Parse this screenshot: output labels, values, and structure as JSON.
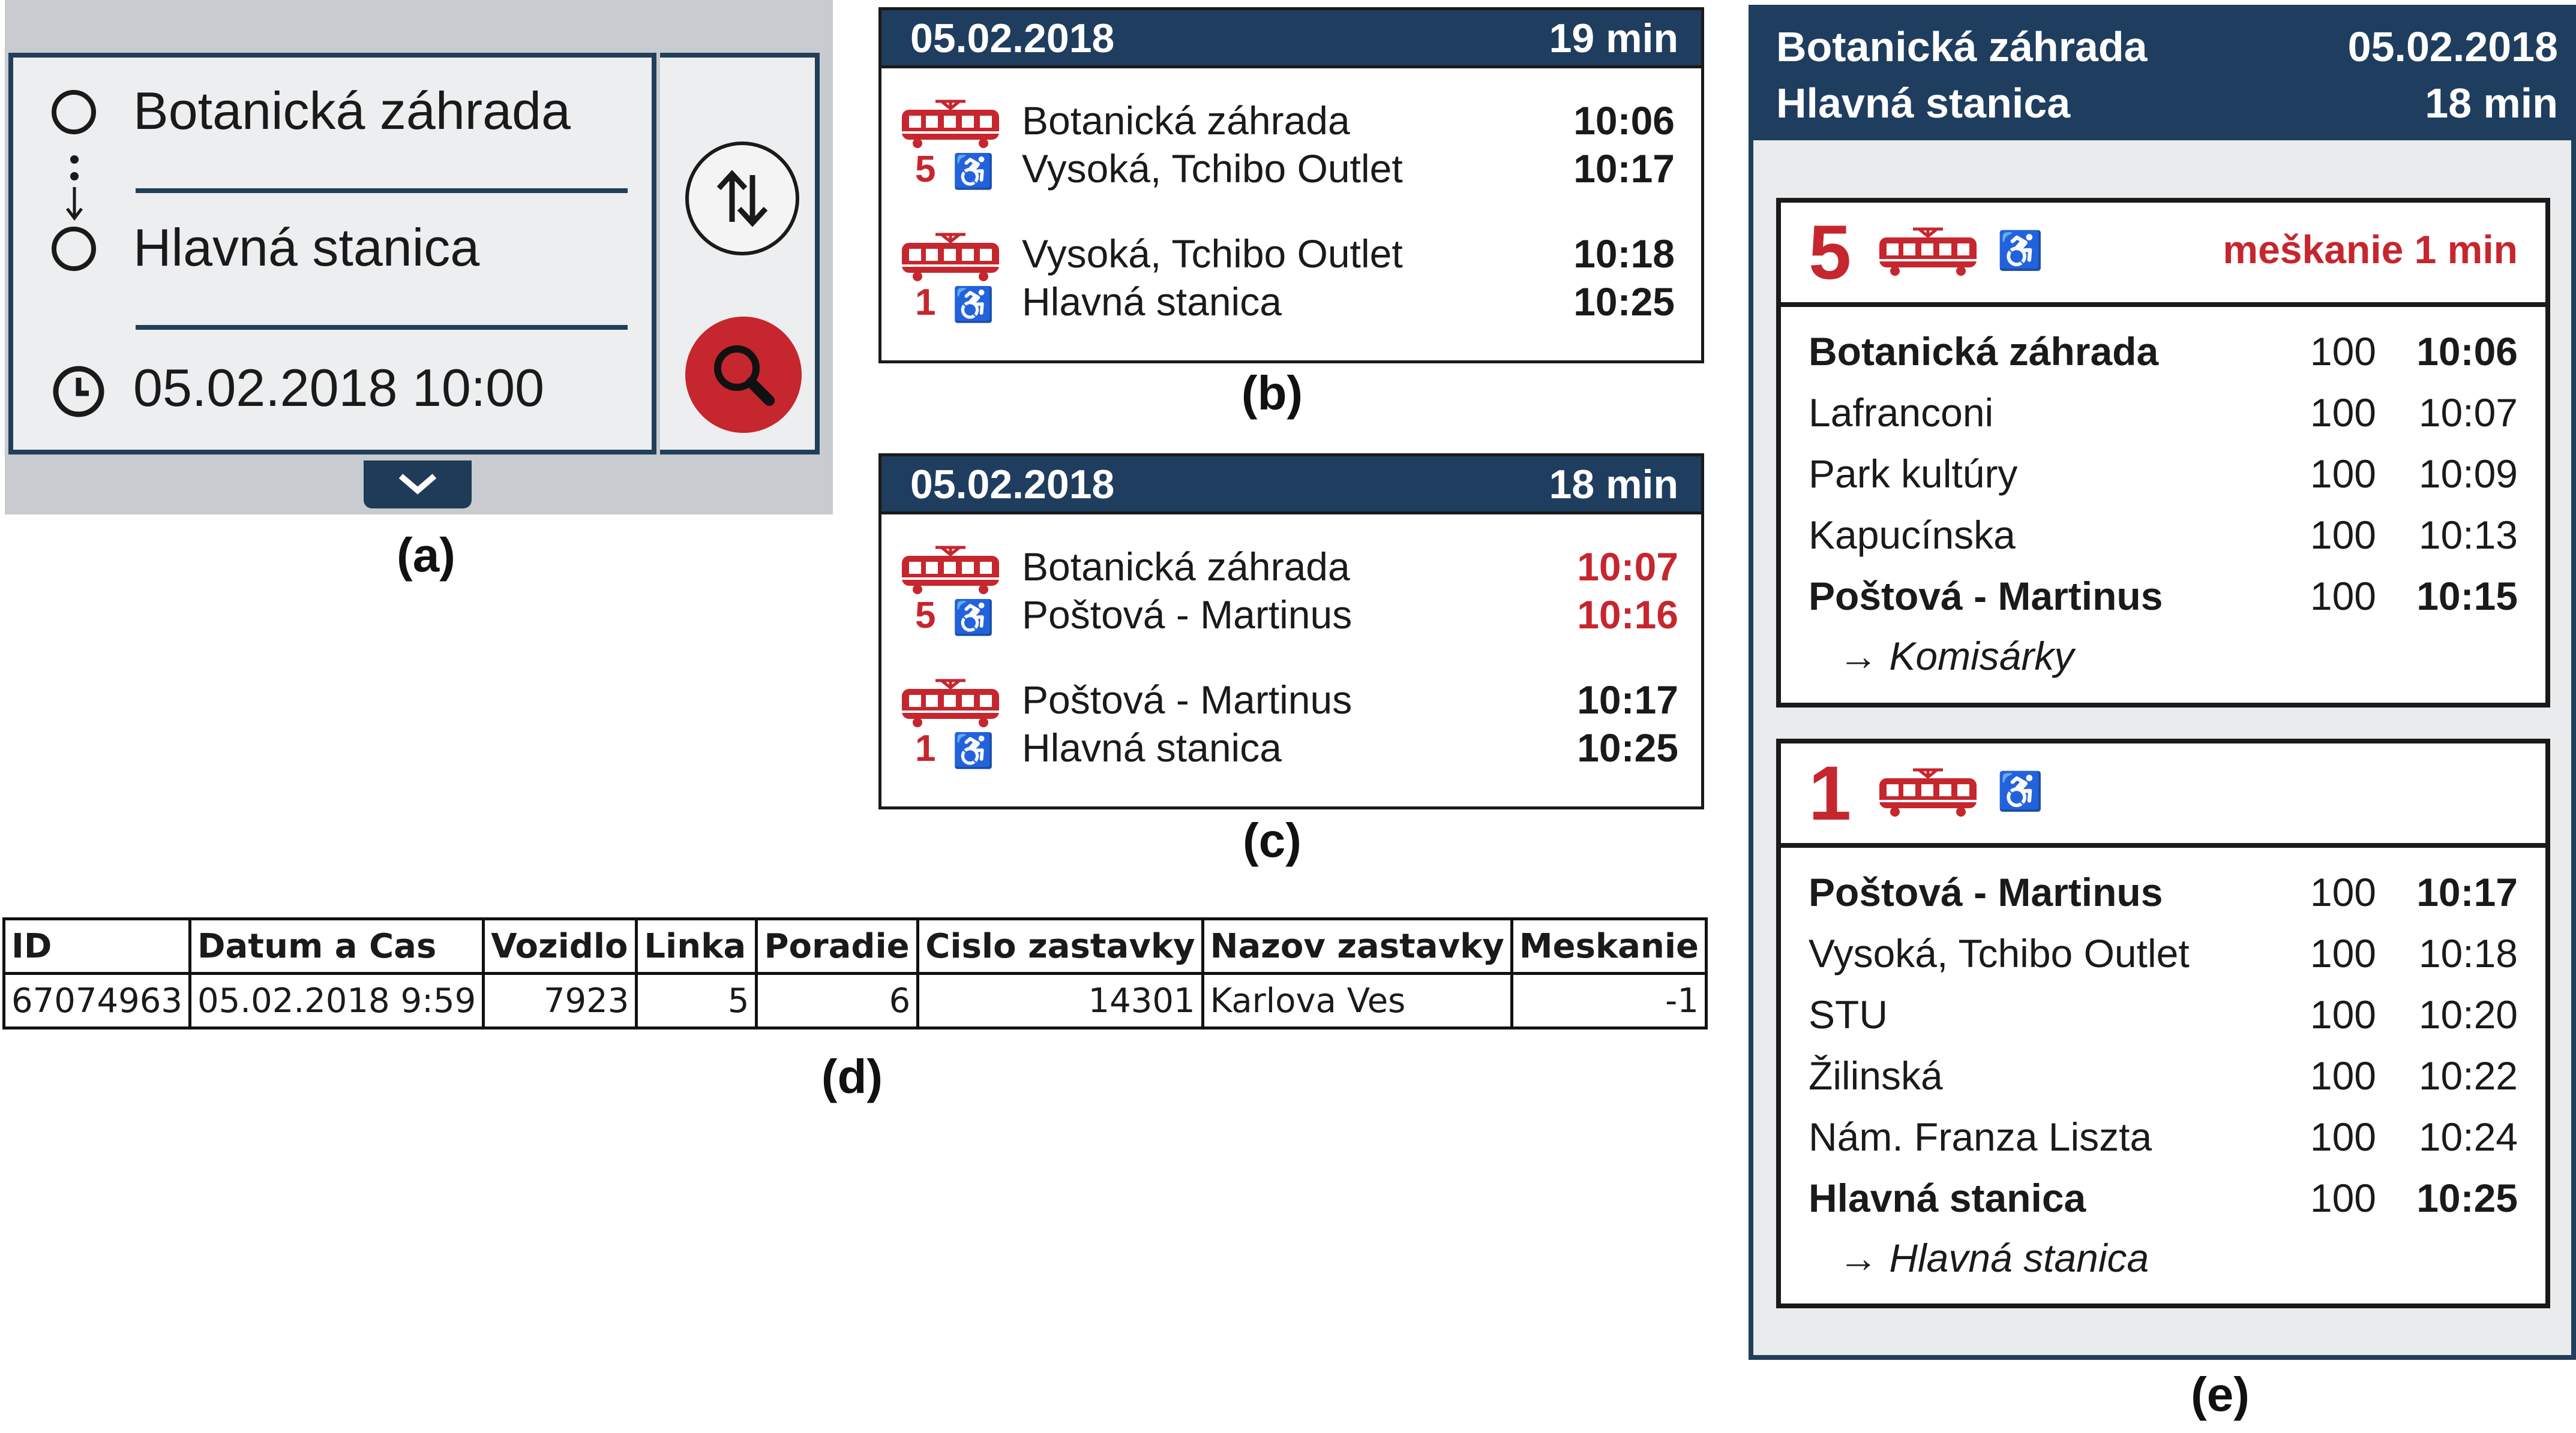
{
  "panel_a": {
    "from": "Botanická záhrada",
    "to": "Hlavná stanica",
    "datetime": "05.02.2018 10:00",
    "caption": "(a)"
  },
  "panel_b": {
    "date": "05.02.2018",
    "duration": "19 min",
    "legs": [
      {
        "line": "5",
        "from": "Botanická záhrada",
        "to": "Vysoká, Tchibo Outlet",
        "dep": "10:06",
        "arr": "10:17"
      },
      {
        "line": "1",
        "from": "Vysoká, Tchibo Outlet",
        "to": "Hlavná stanica",
        "dep": "10:18",
        "arr": "10:25"
      }
    ],
    "caption": "(b)"
  },
  "panel_c": {
    "date": "05.02.2018",
    "duration": "18 min",
    "legs": [
      {
        "line": "5",
        "from": "Botanická záhrada",
        "to": "Poštová - Martinus",
        "dep": "10:07",
        "arr": "10:16"
      },
      {
        "line": "1",
        "from": "Poštová - Martinus",
        "to": "Hlavná stanica",
        "dep": "10:17",
        "arr": "10:25"
      }
    ],
    "caption": "(c)"
  },
  "panel_d": {
    "headers": [
      "ID",
      "Datum a Cas",
      "Vozidlo",
      "Linka",
      "Poradie",
      "Cislo zastavky",
      "Nazov zastavky",
      "Meskanie"
    ],
    "row": [
      "67074963",
      "05.02.2018 9:59",
      "7923",
      "5",
      "6",
      "14301",
      "Karlova Ves",
      "-1"
    ],
    "caption": "(d)"
  },
  "panel_e": {
    "from": "Botanická záhrada",
    "to": "Hlavná stanica",
    "date": "05.02.2018",
    "duration": "18 min",
    "legs": [
      {
        "line": "5",
        "delay": "meškanie 1 min",
        "stops": [
          {
            "name": "Botanická záhrada",
            "code": "100",
            "time": "10:06"
          },
          {
            "name": "Lafranconi",
            "code": "100",
            "time": "10:07"
          },
          {
            "name": "Park kultúry",
            "code": "100",
            "time": "10:09"
          },
          {
            "name": "Kapucínska",
            "code": "100",
            "time": "10:13"
          },
          {
            "name": "Poštová - Martinus",
            "code": "100",
            "time": "10:15"
          }
        ],
        "direction": "→ Komisárky"
      },
      {
        "line": "1",
        "delay": "",
        "stops": [
          {
            "name": "Poštová - Martinus",
            "code": "100",
            "time": "10:17"
          },
          {
            "name": "Vysoká, Tchibo Outlet",
            "code": "100",
            "time": "10:18"
          },
          {
            "name": "STU",
            "code": "100",
            "time": "10:20"
          },
          {
            "name": "Žilinská",
            "code": "100",
            "time": "10:22"
          },
          {
            "name": "Nám. Franza Liszta",
            "code": "100",
            "time": "10:24"
          },
          {
            "name": "Hlavná stanica",
            "code": "100",
            "time": "10:25"
          }
        ],
        "direction": "→ Hlavná stanica"
      }
    ],
    "caption": "(e)"
  },
  "colors": {
    "accent_red": "#c6262e",
    "header_blue": "#1f3d5e",
    "panel_gray": "#c8cbcf"
  },
  "icons": [
    "location-circle-icon",
    "clock-icon",
    "swap-icon",
    "search-icon",
    "chevron-down-icon",
    "tram-icon",
    "wheelchair-icon"
  ]
}
